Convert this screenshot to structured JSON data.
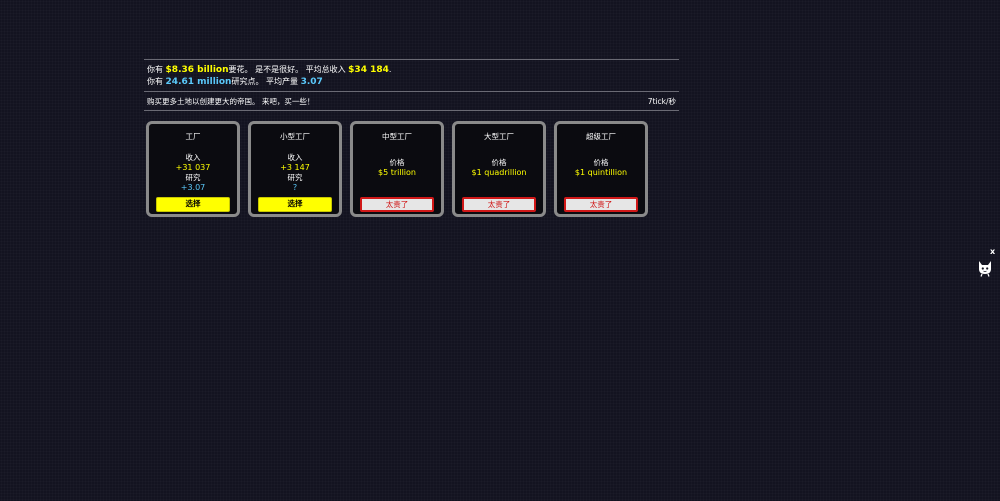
{
  "stats": {
    "line1_prefix": "你有 ",
    "money": "$8.36 billion",
    "line1_mid": "要花。 是不是很好。 平均总收入 ",
    "avg_income": "$34 184",
    "line1_suffix": ".",
    "line2_prefix": "你有 ",
    "research": "24.61 million",
    "line2_mid": "研究点。 平均产量 ",
    "avg_output": "3.07"
  },
  "bar": {
    "message": "购买更多土地以创建更大的帝国。 来吧，买一些！",
    "speed": "7tick/秒"
  },
  "cards": [
    {
      "name": "工厂",
      "label1": "收入",
      "value1": "+31 037",
      "label2": "研究",
      "value2": "+3.07",
      "button": "选择"
    },
    {
      "name": "小型工厂",
      "label1": "收入",
      "value1": "+3 147",
      "label2": "研究",
      "value2": "?",
      "button": "选择"
    },
    {
      "name": "中型工厂",
      "label1": "价格",
      "value1": "$5 trillion",
      "button": "太贵了"
    },
    {
      "name": "大型工厂",
      "label1": "价格",
      "value1": "$1 quadrillion",
      "button": "太贵了"
    },
    {
      "name": "超级工厂",
      "label1": "价格",
      "value1": "$1 quintillion",
      "button": "太贵了"
    }
  ],
  "side": {
    "close": "x",
    "icon": "github-cat-icon"
  },
  "colors": {
    "background": "#131320",
    "money": "#ffff00",
    "research": "#5ac8fa",
    "expensive": "#d01010"
  }
}
